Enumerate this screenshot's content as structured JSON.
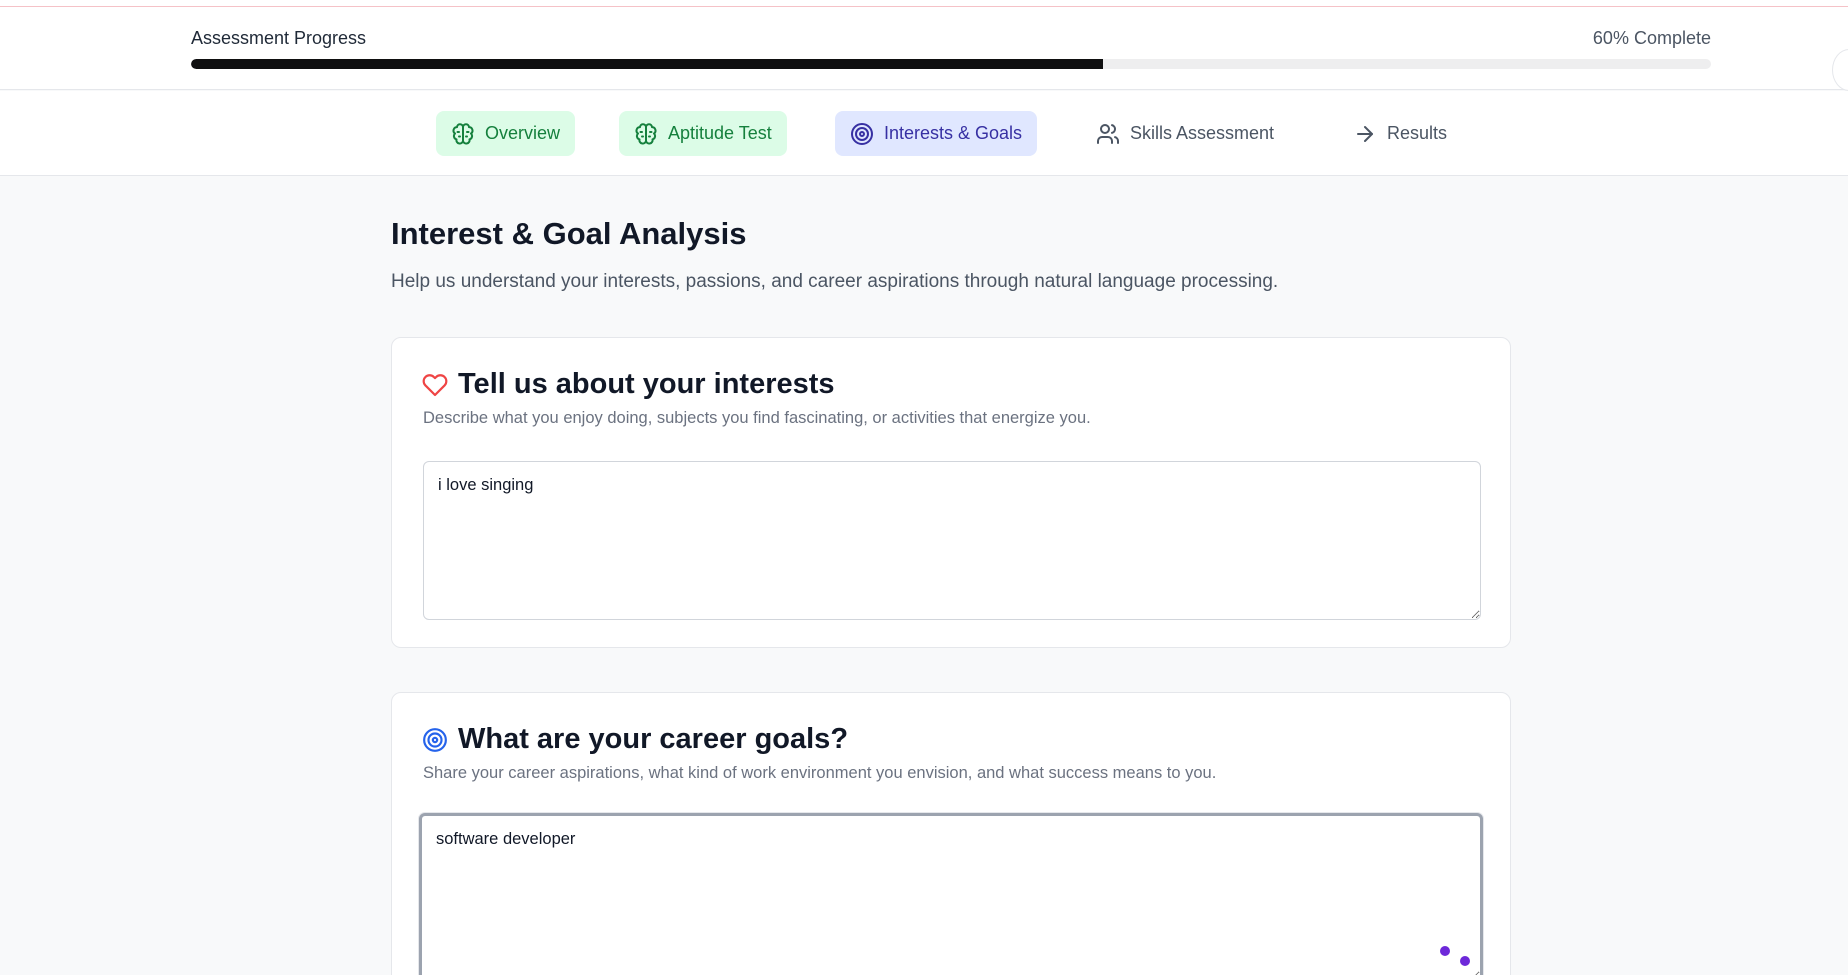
{
  "progress": {
    "label": "Assessment Progress",
    "percent_text": "60% Complete",
    "value": 0.6
  },
  "tabs": [
    {
      "label": "Overview",
      "state": "done",
      "icon": "brain-icon"
    },
    {
      "label": "Aptitude Test",
      "state": "done",
      "icon": "brain-icon"
    },
    {
      "label": "Interests & Goals",
      "state": "active",
      "icon": "target-icon"
    },
    {
      "label": "Skills Assessment",
      "state": "pending",
      "icon": "users-icon"
    },
    {
      "label": "Results",
      "state": "pending",
      "icon": "arrow-right-icon"
    }
  ],
  "page": {
    "title": "Interest & Goal Analysis",
    "subtitle": "Help us understand your interests, passions, and career aspirations through natural language processing."
  },
  "interests_card": {
    "icon": "heart-icon",
    "title": "Tell us about your interests",
    "description": "Describe what you enjoy doing, subjects you find fascinating, or activities that energize you.",
    "value": "i love singing"
  },
  "goals_card": {
    "icon": "target-icon",
    "title": "What are your career goals?",
    "description": "Share your career aspirations, what kind of work environment you envision, and what success means to you.",
    "value": "software developer"
  },
  "colors": {
    "done_bg": "#dcfce7",
    "done_text": "#15803d",
    "active_bg": "#e0e7ff",
    "active_text": "#3730a3",
    "heart": "#ef4444",
    "target_blue": "#2563eb",
    "typing_dots": "#6d28d9"
  }
}
